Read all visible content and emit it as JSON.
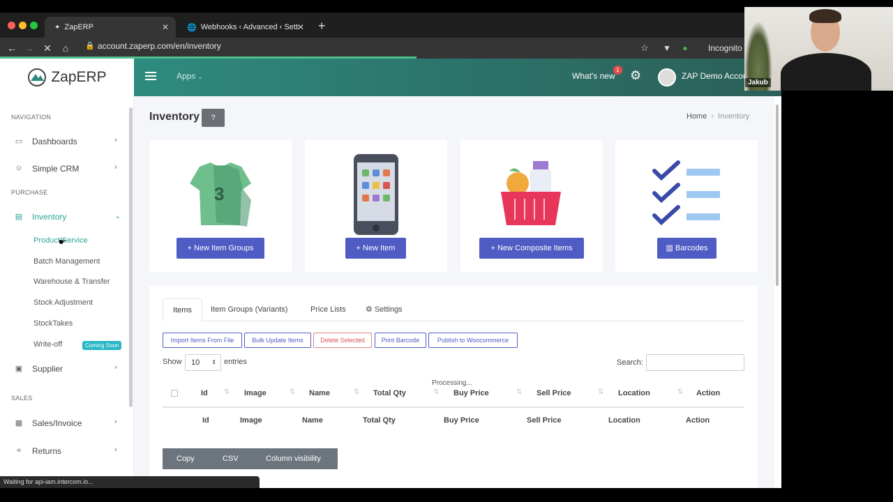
{
  "browser": {
    "tabs": [
      {
        "label": "ZapERP",
        "active": true
      },
      {
        "label": "Webhooks ‹ Advanced ‹ Settin",
        "active": false
      }
    ],
    "url": "account.zaperp.com/en/inventory",
    "profile": "Incognito",
    "status_text": "Waiting for api-iam.intercom.io..."
  },
  "header": {
    "logo": "ZapERP",
    "apps_label": "Apps",
    "whats_new_label": "What's new",
    "notification_count": "1",
    "account_name": "ZAP Demo Accou"
  },
  "sidebar": {
    "sections": {
      "navigation": "NAVIGATION",
      "purchase": "PURCHASE",
      "sales": "SALES"
    },
    "items": {
      "dashboards": "Dashboards",
      "simple_crm": "Simple CRM",
      "inventory": "Inventory",
      "supplier": "Supplier",
      "sales_invoice": "Sales/Invoice",
      "returns": "Returns"
    },
    "sub_items": [
      "Product/Service",
      "Batch Management",
      "Warehouse & Transfer",
      "Stock Adjustment",
      "StockTakes",
      "Write-off"
    ],
    "coming_soon": "Coming Soon"
  },
  "page": {
    "title": "Inventory",
    "breadcrumb": {
      "home": "Home",
      "current": "Inventory"
    }
  },
  "cards": {
    "item_groups": "New Item Groups",
    "item": "New Item",
    "composite": "New Composite Items",
    "barcodes": "Barcodes"
  },
  "tabs": {
    "items": "Items",
    "item_groups": "Item Groups (Variants)",
    "price_lists": "Price Lists",
    "settings": "Settings"
  },
  "actions": {
    "import": "Import Items From File",
    "bulk_update": "Bulk Update Items",
    "delete": "Delete Selected",
    "print_barcode": "Print Barcode",
    "publish": "Publish to Woocommerce"
  },
  "table": {
    "show_label": "Show",
    "page_size": "10",
    "entries_label": "entries",
    "search_label": "Search:",
    "processing": "Processing...",
    "columns": [
      "Id",
      "Image",
      "Name",
      "Total Qty",
      "Buy Price",
      "Sell Price",
      "Location",
      "Action"
    ]
  },
  "export": {
    "copy": "Copy",
    "csv": "CSV",
    "column_visibility": "Column visibility"
  },
  "webcam": {
    "name": "Jakub"
  },
  "colors": {
    "accent": "#4f5cc3",
    "header": "#2e8b7f",
    "sidebar_active": "#2aa198",
    "danger": "#d9534f"
  }
}
